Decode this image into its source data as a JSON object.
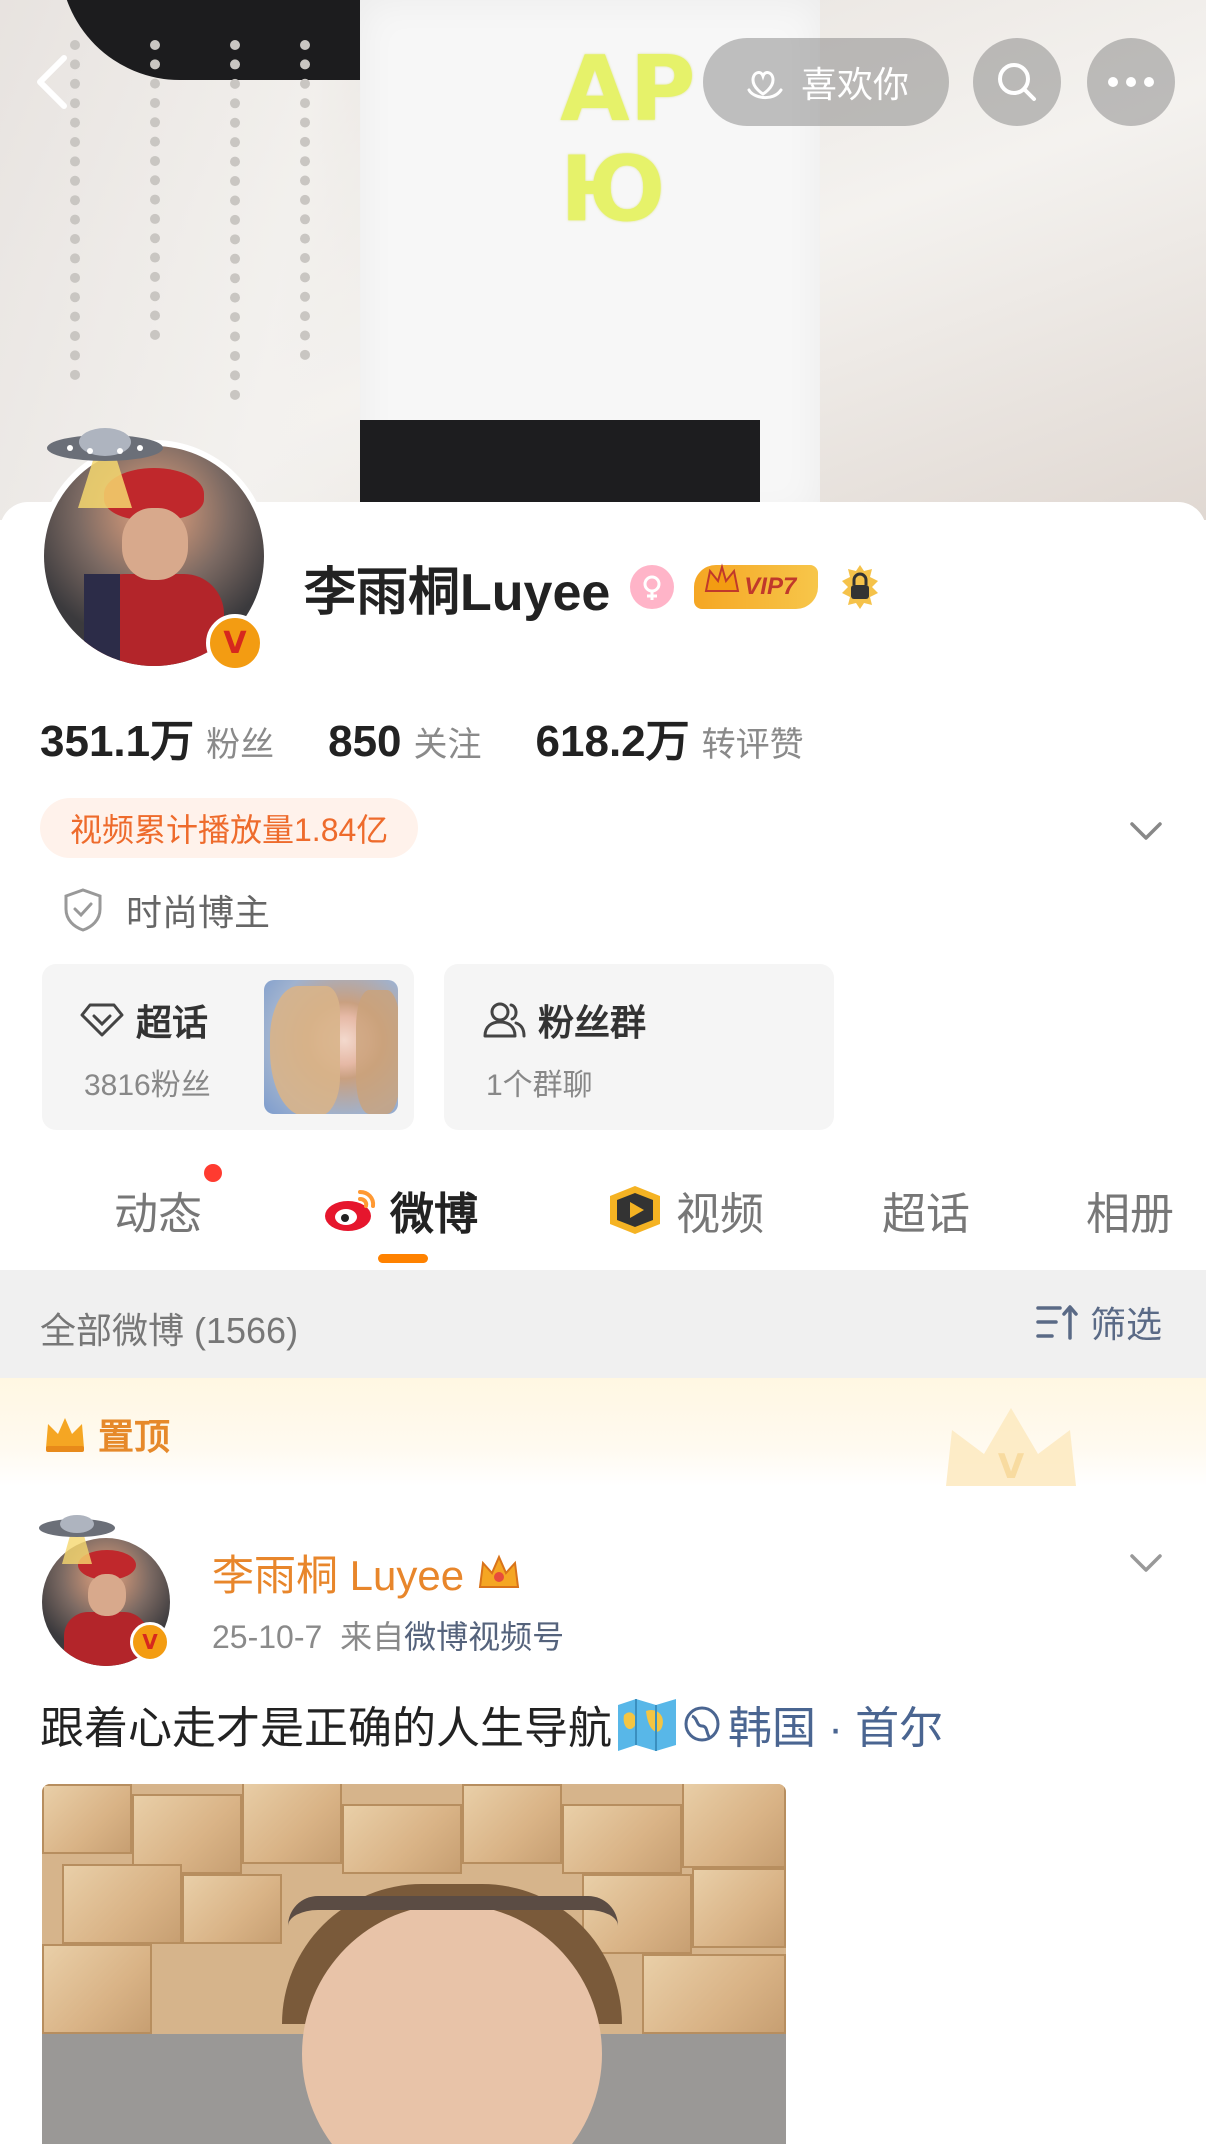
{
  "header": {
    "like_label": "喜欢你",
    "cover_text": "АР\nЮ"
  },
  "profile": {
    "name": "李雨桐Luyee",
    "vip_label": "VIP7",
    "stats": [
      {
        "value": "351.1万",
        "label": "粉丝"
      },
      {
        "value": "850",
        "label": "关注"
      },
      {
        "value": "618.2万",
        "label": "转评赞"
      }
    ],
    "video_plays": "视频累计播放量1.84亿",
    "tag": "时尚博主",
    "cards": {
      "chaohua": {
        "title": "超话",
        "sub": "3816粉丝"
      },
      "fans": {
        "title": "粉丝群",
        "sub": "1个群聊"
      }
    }
  },
  "tabs": [
    {
      "label": "动态",
      "active": false
    },
    {
      "label": "微博",
      "active": true
    },
    {
      "label": "视频",
      "active": false
    },
    {
      "label": "超话",
      "active": false
    },
    {
      "label": "相册",
      "active": false
    }
  ],
  "filter": {
    "label": "全部微博 (1566)",
    "button": "筛选"
  },
  "pinned": {
    "label": "置顶"
  },
  "post": {
    "author": "李雨桐 Luyee",
    "date": "25-10-7",
    "source_prefix": "来自",
    "source": "微博视频号",
    "text": "跟着心走才是正确的人生导航",
    "location": "韩国 · 首尔"
  },
  "colors": {
    "accent": "#ff8200",
    "name_orange": "#e8862b",
    "link_blue": "#4a6591",
    "pill_bg": "#fff2eb"
  }
}
